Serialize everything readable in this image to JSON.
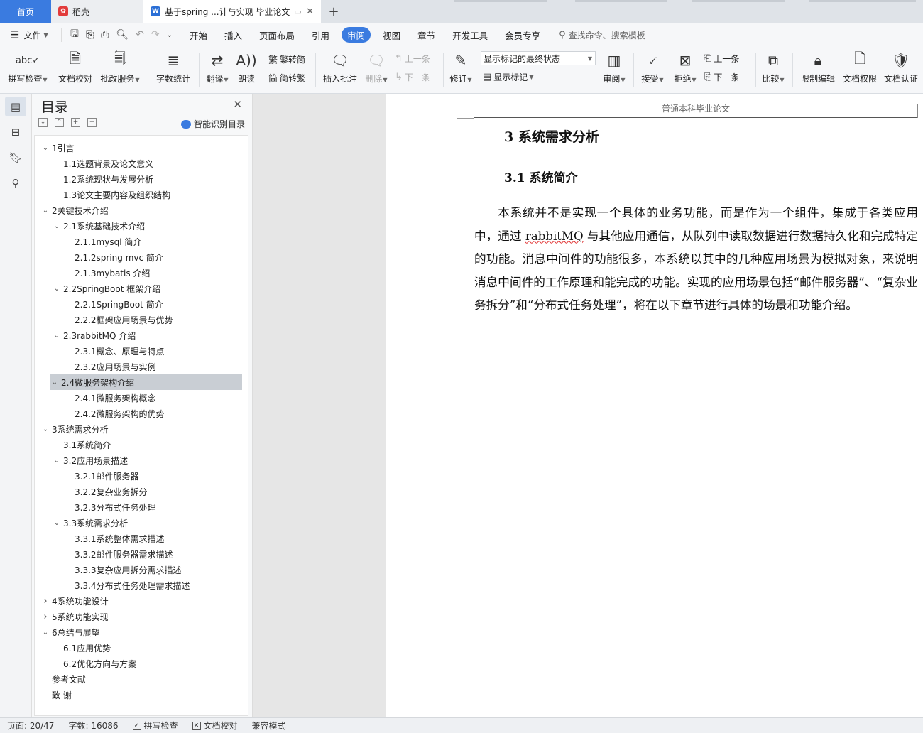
{
  "tabs": {
    "home": "首页",
    "docer": "稻壳",
    "document": "基于spring ...计与实现 毕业论文",
    "add": "+"
  },
  "menu": {
    "file": "文件",
    "tabs": [
      "开始",
      "插入",
      "页面布局",
      "引用",
      "审阅",
      "视图",
      "章节",
      "开发工具",
      "会员专享"
    ],
    "active_tab": "审阅",
    "search": "查找命令、搜索模板"
  },
  "ribbon": {
    "spell_check": "拼写检查",
    "doc_proofread": "文档校对",
    "batch_service": "批改服务",
    "word_count": "字数统计",
    "translate": "翻译",
    "read_aloud": "朗读",
    "to_traditional": "繁转简",
    "to_simplified": "简转繁",
    "insert_comment": "插入批注",
    "delete": "删除",
    "prev_comment": "上一条",
    "next_comment": "下一条",
    "revise": "修订",
    "markup_state": "显示标记的最终状态",
    "show_markup": "显示标记",
    "review": "审阅",
    "accept": "接受",
    "reject": "拒绝",
    "prev_change": "上一条",
    "next_change": "下一条",
    "compare": "比较",
    "restrict_edit": "限制编辑",
    "doc_permission": "文档权限",
    "doc_certify": "文档认证"
  },
  "toc": {
    "title": "目录",
    "smart": "智能识别目录",
    "items": [
      {
        "label": "1引言",
        "level": 1,
        "chev": "open"
      },
      {
        "label": "1.1选题背景及论文意义",
        "level": 2,
        "chev": "none"
      },
      {
        "label": "1.2系统现状与发展分析",
        "level": 2,
        "chev": "none"
      },
      {
        "label": "1.3论文主要内容及组织结构",
        "level": 2,
        "chev": "none"
      },
      {
        "label": "2关键技术介绍",
        "level": 1,
        "chev": "open"
      },
      {
        "label": "2.1系统基础技术介绍",
        "level": 2,
        "chev": "open"
      },
      {
        "label": "2.1.1mysql 简介",
        "level": 3,
        "chev": "none"
      },
      {
        "label": "2.1.2spring mvc 简介",
        "level": 3,
        "chev": "none"
      },
      {
        "label": "2.1.3mybatis 介绍",
        "level": 3,
        "chev": "none"
      },
      {
        "label": "2.2SpringBoot 框架介绍",
        "level": 2,
        "chev": "open"
      },
      {
        "label": "2.2.1SpringBoot 简介",
        "level": 3,
        "chev": "none"
      },
      {
        "label": "2.2.2框架应用场景与优势",
        "level": 3,
        "chev": "none"
      },
      {
        "label": "2.3rabbitMQ 介绍",
        "level": 2,
        "chev": "open"
      },
      {
        "label": "2.3.1概念、原理与特点",
        "level": 3,
        "chev": "none"
      },
      {
        "label": "2.3.2应用场景与实例",
        "level": 3,
        "chev": "none"
      },
      {
        "label": "2.4微服务架构介绍",
        "level": 2,
        "chev": "open",
        "selected": true
      },
      {
        "label": "2.4.1微服务架构概念",
        "level": 3,
        "chev": "none"
      },
      {
        "label": "2.4.2微服务架构的优势",
        "level": 3,
        "chev": "none"
      },
      {
        "label": "3系统需求分析",
        "level": 1,
        "chev": "open"
      },
      {
        "label": "3.1系统简介",
        "level": 2,
        "chev": "none"
      },
      {
        "label": "3.2应用场景描述",
        "level": 2,
        "chev": "open"
      },
      {
        "label": "3.2.1邮件服务器",
        "level": 3,
        "chev": "none"
      },
      {
        "label": "3.2.2复杂业务拆分",
        "level": 3,
        "chev": "none"
      },
      {
        "label": "3.2.3分布式任务处理",
        "level": 3,
        "chev": "none"
      },
      {
        "label": "3.3系统需求分析",
        "level": 2,
        "chev": "open"
      },
      {
        "label": "3.3.1系统整体需求描述",
        "level": 3,
        "chev": "none"
      },
      {
        "label": "3.3.2邮件服务器需求描述",
        "level": 3,
        "chev": "none"
      },
      {
        "label": "3.3.3复杂应用拆分需求描述",
        "level": 3,
        "chev": "none"
      },
      {
        "label": "3.3.4分布式任务处理需求描述",
        "level": 3,
        "chev": "none"
      },
      {
        "label": "4系统功能设计",
        "level": 1,
        "chev": "closed"
      },
      {
        "label": "5系统功能实现",
        "level": 1,
        "chev": "closed"
      },
      {
        "label": "6总结与展望",
        "level": 1,
        "chev": "open"
      },
      {
        "label": "6.1应用优势",
        "level": 2,
        "chev": "none"
      },
      {
        "label": "6.2优化方向与方案",
        "level": 2,
        "chev": "none"
      },
      {
        "label": "参考文献",
        "level": 1,
        "chev": "none"
      },
      {
        "label": "致    谢",
        "level": 1,
        "chev": "none"
      }
    ]
  },
  "document": {
    "header": "普通本科毕业论文",
    "h1": "3  系统需求分析",
    "h2": "3.1     系统简介",
    "p_before": "本系统并不是实现一个具体的业务功能，而是作为一个组件，集成于各类应用中，通过 ",
    "p_flagged": "rabbitMQ",
    "p_after": " 与其他应用通信，从队列中读取数据进行数据持久化和完成特定的功能。消息中间件的功能很多，本系统以其中的几种应用场景为模拟对象，来说明消息中间件的工作原理和能完成的功能。实现的应用场景包括“邮件服务器”、“复杂业务拆分”和“分布式任务处理”，将在以下章节进行具体的场景和功能介绍。"
  },
  "status": {
    "page": "页面: 20/47",
    "words": "字数: 16086",
    "spell": "拼写检查",
    "proof": "文档校对",
    "compat": "兼容模式"
  }
}
